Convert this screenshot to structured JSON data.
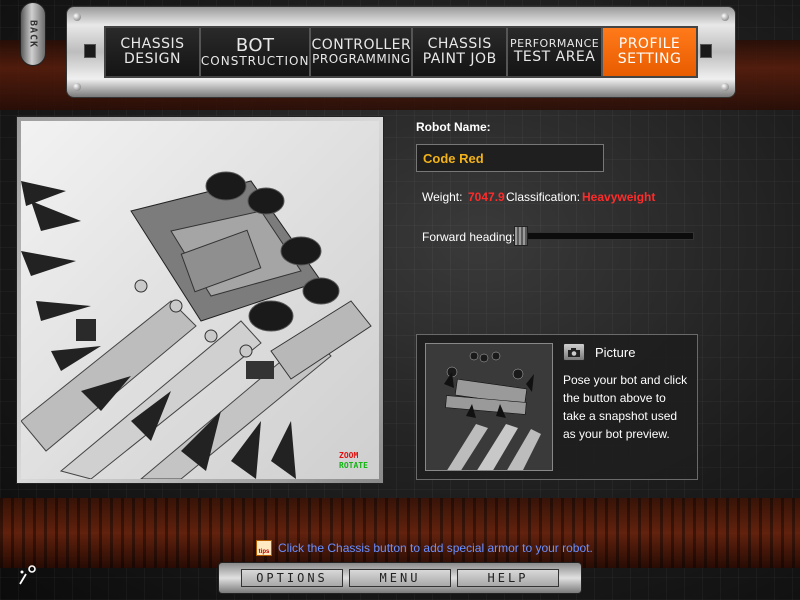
{
  "nav": {
    "back_label": "BACK",
    "tabs": [
      {
        "line1": "CHASSIS",
        "line2": "DESIGN"
      },
      {
        "line1": "BOT",
        "line2": "CONSTRUCTION"
      },
      {
        "line1": "CONTROLLER",
        "line2": "PROGRAMMING"
      },
      {
        "line1": "CHASSIS",
        "line2": "PAINT JOB"
      },
      {
        "line1": "PERFORMANCE",
        "line2": "TEST AREA"
      },
      {
        "line1": "PROFILE",
        "line2": "SETTING"
      }
    ],
    "active_tab_index": 5,
    "active_color": "#ff6a0a"
  },
  "viewport": {
    "zoom_label": "ZOOM",
    "rotate_label": "ROTATE"
  },
  "profile": {
    "robot_name_label": "Robot Name:",
    "robot_name_value": "Code Red",
    "weight_label": "Weight:",
    "weight_value": "7047.9",
    "classification_label": "Classification:",
    "classification_value": "Heavyweight",
    "forward_heading_label": "Forward heading:",
    "value_color": "#ff2b2b",
    "name_color": "#f2b21a"
  },
  "picture": {
    "title": "Picture",
    "description": "Pose your bot and click the button above to take a snapshot used as your bot preview."
  },
  "tip": {
    "icon_label": "tips",
    "text": "Click the Chassis button to add special armor to your robot."
  },
  "bottom": {
    "options_label": "OPTIONS",
    "menu_label": "MENU",
    "help_label": "HELP"
  }
}
